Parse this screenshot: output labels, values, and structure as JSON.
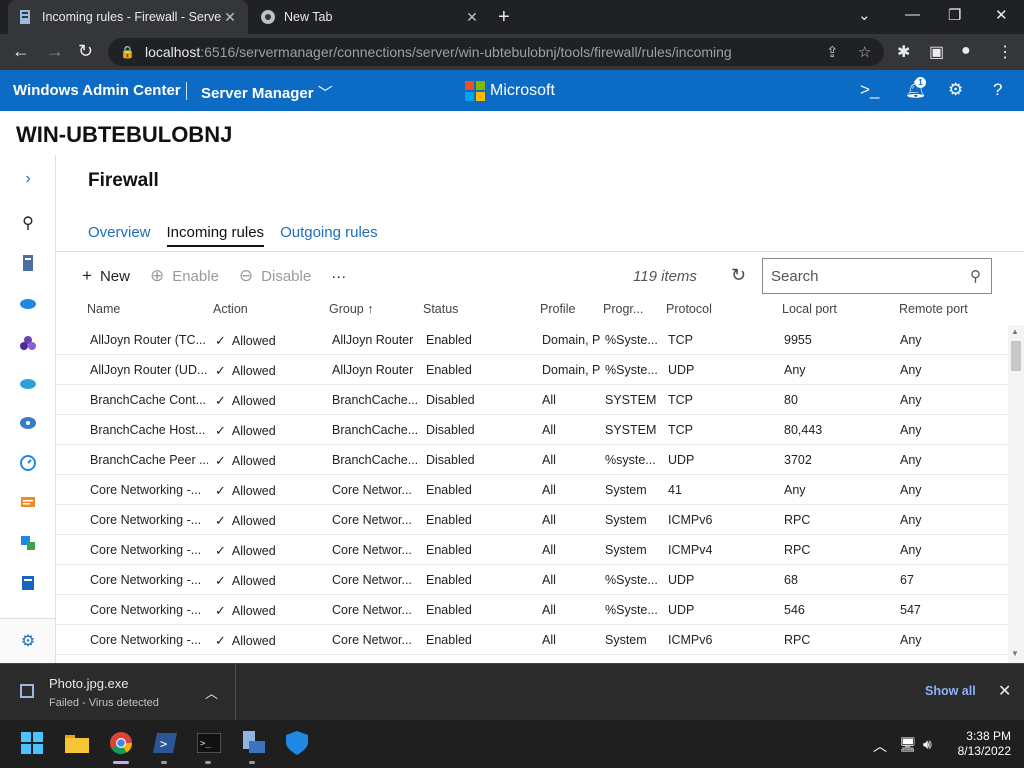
{
  "browser": {
    "tabs": [
      {
        "title": "Incoming rules - Firewall - Server Manager"
      },
      {
        "title": "New Tab"
      }
    ],
    "url_host": "localhost",
    "url_path": ":6516/servermanager/connections/server/win-ubtebulobnj/tools/firewall/rules/incoming"
  },
  "header": {
    "app_title": "Windows Admin Center",
    "solution": "Server Manager",
    "brand": "Microsoft",
    "notification_count": "1"
  },
  "server_name": "WIN-UBTEBULOBNJ",
  "tool": {
    "title": "Firewall",
    "tabs": [
      {
        "label": "Overview"
      },
      {
        "label": "Incoming rules"
      },
      {
        "label": "Outgoing rules"
      }
    ]
  },
  "commands": {
    "new": "New",
    "enable": "Enable",
    "disable": "Disable",
    "more": "···",
    "items_count": "119 items",
    "search_placeholder": "Search"
  },
  "table": {
    "columns": [
      "Name",
      "Action",
      "Group",
      "Status",
      "Profile",
      "Progr...",
      "Protocol",
      "Local port",
      "Remote port"
    ],
    "rows": [
      [
        "AllJoyn Router (TC...",
        "Allowed",
        "AllJoyn Router",
        "Enabled",
        "Domain, P",
        "%Syste...",
        "TCP",
        "9955",
        "Any"
      ],
      [
        "AllJoyn Router (UD...",
        "Allowed",
        "AllJoyn Router",
        "Enabled",
        "Domain, P",
        "%Syste...",
        "UDP",
        "Any",
        "Any"
      ],
      [
        "BranchCache Cont...",
        "Allowed",
        "BranchCache...",
        "Disabled",
        "All",
        "SYSTEM",
        "TCP",
        "80",
        "Any"
      ],
      [
        "BranchCache Host...",
        "Allowed",
        "BranchCache...",
        "Disabled",
        "All",
        "SYSTEM",
        "TCP",
        "80,443",
        "Any"
      ],
      [
        "BranchCache Peer ...",
        "Allowed",
        "BranchCache...",
        "Disabled",
        "All",
        "%syste...",
        "UDP",
        "3702",
        "Any"
      ],
      [
        "Core Networking -...",
        "Allowed",
        "Core Networ...",
        "Enabled",
        "All",
        "System",
        "41",
        "Any",
        "Any"
      ],
      [
        "Core Networking -...",
        "Allowed",
        "Core Networ...",
        "Enabled",
        "All",
        "System",
        "ICMPv6",
        "RPC",
        "Any"
      ],
      [
        "Core Networking -...",
        "Allowed",
        "Core Networ...",
        "Enabled",
        "All",
        "System",
        "ICMPv4",
        "RPC",
        "Any"
      ],
      [
        "Core Networking -...",
        "Allowed",
        "Core Networ...",
        "Enabled",
        "All",
        "%Syste...",
        "UDP",
        "68",
        "67"
      ],
      [
        "Core Networking -...",
        "Allowed",
        "Core Networ...",
        "Enabled",
        "All",
        "%Syste...",
        "UDP",
        "546",
        "547"
      ],
      [
        "Core Networking -...",
        "Allowed",
        "Core Networ...",
        "Enabled",
        "All",
        "System",
        "ICMPv6",
        "RPC",
        "Any"
      ]
    ]
  },
  "download": {
    "file": "Photo.jpg.exe",
    "status": "Failed - Virus detected",
    "show_all": "Show all"
  },
  "taskbar": {
    "time": "3:38 PM",
    "date": "8/13/2022"
  },
  "colors": {
    "wac_blue": "#0b6bc5",
    "link_blue": "#1a6fbf",
    "ms_red": "#f25022",
    "ms_green": "#7fba00",
    "ms_blue": "#00a4ef",
    "ms_yellow": "#ffb900"
  }
}
